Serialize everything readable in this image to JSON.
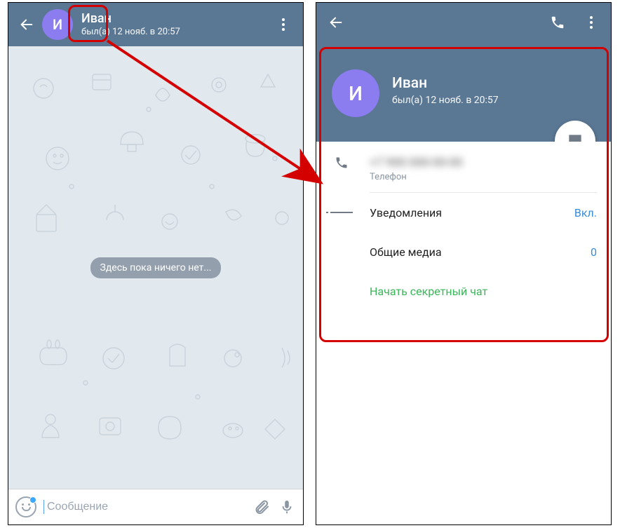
{
  "chat": {
    "avatar_letter": "И",
    "contact_name": "Иван",
    "last_seen": "был(а) 12 нояб. в 20:57",
    "empty_state": "Здесь пока ничего нет...",
    "input_placeholder": "Сообщение"
  },
  "profile": {
    "avatar_letter": "И",
    "contact_name": "Иван",
    "last_seen": "был(а) 12 нояб. в 20:57",
    "phone_masked": "+7 900 000-00-00",
    "phone_label": "Телефон",
    "rows": {
      "notifications_label": "Уведомления",
      "notifications_value": "Вкл.",
      "shared_media_label": "Общие медиа",
      "shared_media_value": "0",
      "secret_chat_label": "Начать секретный чат"
    }
  }
}
